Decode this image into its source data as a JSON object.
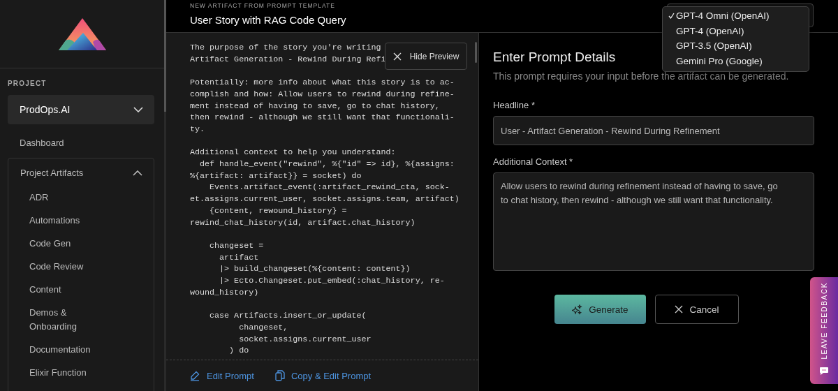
{
  "sidebar": {
    "section_label": "PROJECT",
    "project_select": {
      "value": "ProdOps.AI"
    },
    "nav": [
      {
        "label": "Dashboard"
      }
    ],
    "group": {
      "label": "Project Artifacts",
      "expanded": true,
      "items": [
        {
          "label": "ADR"
        },
        {
          "label": "Automations"
        },
        {
          "label": "Code Gen"
        },
        {
          "label": "Code Review"
        },
        {
          "label": "Content"
        },
        {
          "label": "Demos & Onboarding"
        },
        {
          "label": "Documentation"
        },
        {
          "label": "Elixir Function"
        }
      ]
    }
  },
  "header": {
    "overline": "NEW ARTIFACT FROM PROMPT TEMPLATE",
    "title": "User Story with RAG Code Query",
    "model_select": {
      "options": [
        {
          "label": "GPT-4 Omni (OpenAI)",
          "selected": true
        },
        {
          "label": "GPT-4 (OpenAI)",
          "selected": false
        },
        {
          "label": "GPT-3.5 (OpenAI)",
          "selected": false
        },
        {
          "label": "Gemini Pro (Google)",
          "selected": false
        }
      ]
    }
  },
  "preview": {
    "hide_button": {
      "label": "Hide Preview"
    },
    "blocks": [
      [
        "The purpose of the story you're writing",
        "Artifact Generation - Rewind During Refi"
      ],
      [
        "Potentially: more info about what this story is to ac-",
        "complish and how: Allow users to rewind during refine-",
        "ment instead of having to save, go to chat history,",
        "then rewind - although we still want that functionali-",
        "ty."
      ],
      [
        "Additional context to help you understand:",
        "  def handle_event(\"rewind\", %{\"id\" => id}, %{assigns:",
        "%{artifact: artifact}} = socket) do",
        "    Events.artifact_event(:artifact_rewind_cta, sock-",
        "et.assigns.current_user, socket.assigns.team, artifact)",
        "    {content, rewound_history} =",
        "rewind_chat_history(id, artifact.chat_history)"
      ],
      [
        "    changeset =",
        "      artifact",
        "      |> build_changeset(%{content: content})",
        "      |> Ecto.Changeset.put_embed(:chat_history, re-",
        "wound_history)"
      ],
      [
        "    case Artifacts.insert_or_update(",
        "          changeset,",
        "          socket.assigns.current_user",
        "        ) do"
      ]
    ],
    "actions": [
      {
        "label": "Edit Prompt",
        "kind": "edit"
      },
      {
        "label": "Copy & Edit Prompt",
        "kind": "copy"
      }
    ]
  },
  "form": {
    "title": "Enter Prompt Details",
    "subtitle": "This prompt requires your input before the artifact can be generated.",
    "fields": [
      {
        "label": "Headline *",
        "kind": "input",
        "value": "User - Artifact Generation - Rewind During Refinement"
      },
      {
        "label": "Additional Context *",
        "kind": "textarea",
        "value": "Allow users to rewind during refinement instead of having to save, go to chat history, then rewind - although we still want that functionality."
      }
    ],
    "buttons": [
      {
        "label": "Generate",
        "kind": "primary"
      },
      {
        "label": "Cancel",
        "kind": "secondary"
      }
    ]
  },
  "feedback_tab": {
    "label": "LEAVE FEEDBACK"
  }
}
